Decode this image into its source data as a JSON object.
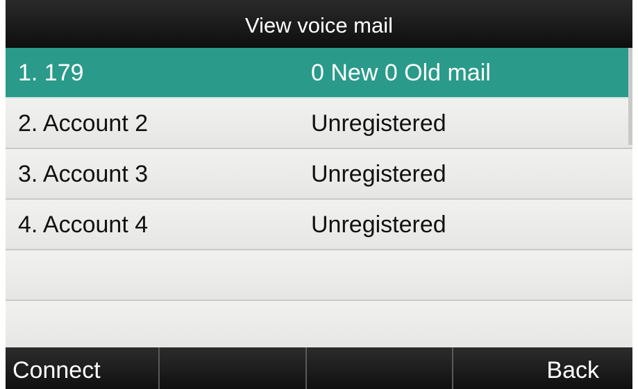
{
  "title": "View voice mail",
  "accounts": [
    {
      "name": "1. 179",
      "status": "0 New 0 Old mail",
      "selected": true
    },
    {
      "name": "2. Account 2",
      "status": "Unregistered"
    },
    {
      "name": "3. Account 3",
      "status": "Unregistered"
    },
    {
      "name": "4. Account 4",
      "status": "Unregistered"
    }
  ],
  "softkeys": {
    "key1": "Connect",
    "key2": "",
    "key3": "",
    "key4": "Back"
  },
  "colors": {
    "selected_row": "#2a9a8a",
    "title_bar": "#1a1a1a",
    "list_background": "#ececea"
  }
}
